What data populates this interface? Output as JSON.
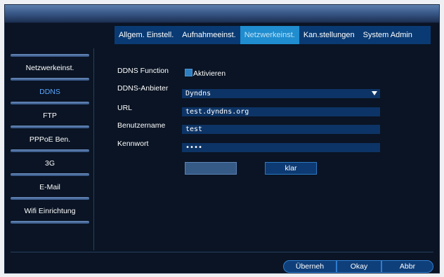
{
  "tabs": [
    {
      "label": "Allgem. Einstell."
    },
    {
      "label": "Aufnahmeeinst."
    },
    {
      "label": "Netzwerkeinst."
    },
    {
      "label": "Kan.stellungen"
    },
    {
      "label": "System Admin"
    }
  ],
  "active_tab": "Netzwerkeinst.",
  "sidebar": {
    "items": [
      {
        "label": "Netzwerkeinst."
      },
      {
        "label": "DDNS"
      },
      {
        "label": "FTP"
      },
      {
        "label": "PPPoE Ben."
      },
      {
        "label": "3G"
      },
      {
        "label": "E-Mail"
      },
      {
        "label": "Wifi Einrichtung"
      }
    ],
    "active": "DDNS"
  },
  "form": {
    "ddns_function": {
      "label": "DDNS Function",
      "checkbox_label": "Aktivieren",
      "checked": true
    },
    "ddns_provider": {
      "label": "DDNS-Anbieter",
      "value": "Dyndns"
    },
    "url": {
      "label": "URL",
      "value": "test.dyndns.org"
    },
    "username": {
      "label": "Benutzername",
      "value": "test"
    },
    "password": {
      "label": "Kennwort",
      "value": "••••"
    }
  },
  "buttons": {
    "test_label": "",
    "clear_label": "klar"
  },
  "bottom": {
    "apply_label": "Überneh",
    "ok_label": "Okay",
    "cancel_label": "Abbr"
  },
  "colors": {
    "background": "#0a1424",
    "tab_bar": "#0a3a73",
    "tab_active": "#1f8dcf",
    "field": "#0d3466",
    "sidebar_active_text": "#5aa7ff"
  }
}
